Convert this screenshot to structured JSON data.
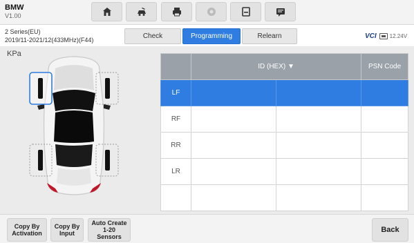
{
  "header": {
    "make": "BMW",
    "version": "V1.00",
    "toolbar_icons": [
      "home-icon",
      "car-service-icon",
      "printer-icon",
      "help-icon",
      "save-icon",
      "message-icon"
    ]
  },
  "subheader": {
    "model_line1": "2 Series(EU)",
    "model_line2": "2019/11-2021/12(433MHz)(F44)",
    "tabs": [
      {
        "label": "Check",
        "active": false
      },
      {
        "label": "Programming",
        "active": true
      },
      {
        "label": "Relearn",
        "active": false
      }
    ],
    "vci_label": "VCI",
    "battery": "12.24V"
  },
  "main": {
    "unit_label": "KPa",
    "table": {
      "headers": [
        "",
        "ID (HEX) ▼",
        "PSN Code"
      ],
      "rows": [
        {
          "pos": "LF",
          "selected": true
        },
        {
          "pos": "RF",
          "selected": false
        },
        {
          "pos": "RR",
          "selected": false
        },
        {
          "pos": "LR",
          "selected": false
        },
        {
          "pos": "",
          "selected": false
        }
      ]
    }
  },
  "footer": {
    "copy_activation": "Copy By\nActivation",
    "copy_input": "Copy By\nInput",
    "auto_create": "Auto Create\n1-20\nSensors",
    "back": "Back"
  },
  "colors": {
    "accent": "#2f7de1",
    "header_cell": "#9aa1a8"
  }
}
